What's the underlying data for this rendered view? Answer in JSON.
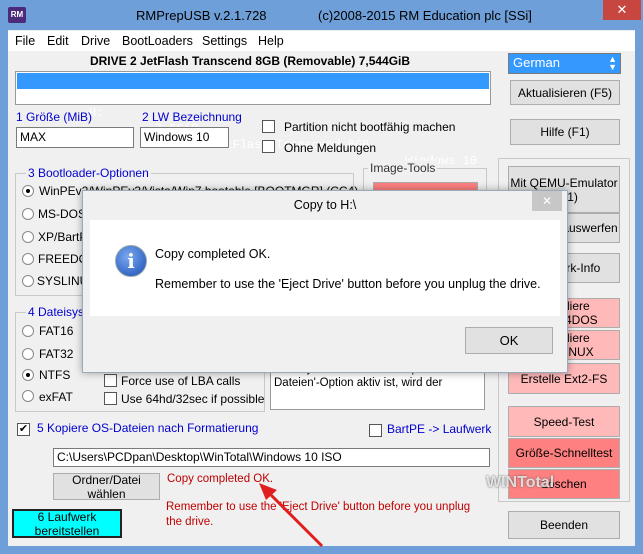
{
  "window": {
    "title": "RMPrepUSB v.2.1.728",
    "copyright": "(c)2008-2015 RM Education plc [SSi]",
    "icon_text": "RM"
  },
  "menu": [
    "File",
    "Edit",
    "Drive",
    "BootLoaders",
    "Settings",
    "Help"
  ],
  "drive_header": "DRIVE 2 JetFlash Transcend 8GB  (Removable) 7,544GiB",
  "drive_list": [
    {
      "drive": "DRIVE 2",
      "letter": "H:",
      "size": "7,5GiB",
      "name": "JetFlash Transcend 8GB",
      "label": "Windows 10"
    }
  ],
  "size": {
    "label": "1 Größe (MiB)",
    "value": "MAX"
  },
  "volume": {
    "label": "2 LW Bezeichnung",
    "value": "Windows 10"
  },
  "checks": {
    "no_boot": "Partition nicht bootfähig machen",
    "no_msg": "Ohne Meldungen"
  },
  "bootloader": {
    "title": "3 Bootloader-Optionen",
    "options": [
      "WinPEv2/WinPEv3/Vista/Win7 bootable [BOOTMGR] (CC4)",
      "MS-DOS",
      "XP/BartPE",
      "FREEDOS",
      "SYSLINUX"
    ],
    "selected": 0
  },
  "image_tools": {
    "title": "Image-Tools"
  },
  "filesystem": {
    "title": "4 Dateisystem",
    "options": [
      "FAT16",
      "FAT32",
      "NTFS",
      "exFAT"
    ],
    "selected": 2,
    "lba": "Force use of LBA calls",
    "hd64": "Use 64hd/32sec if possible",
    "info": "Dateisystem. Wenn die 'Kopiere OS-Dateien'-Option aktiv ist, wird der"
  },
  "copy_os": {
    "label": "5 Kopiere OS-Dateien nach Formatierung",
    "checked": true,
    "bartpe": "BartPE -> Laufwerk",
    "path": "C:\\Users\\PCDpan\\Desktop\\WinTotal\\Windows 10 ISO",
    "browse": "Ordner/Datei wählen"
  },
  "status": {
    "line1": "Copy completed OK.",
    "line2": "Remember to use the 'Eject Drive' button before you unplug the drive."
  },
  "prepare": "6 Laufwerk bereitstellen",
  "right": {
    "language": "German",
    "refresh": "Aktualisieren (F5)",
    "help": "Hilfe (F1)",
    "qemu": "Mit QEMU-Emulator (F11)",
    "eject": "Laufwerk auswerfen",
    "info": "Laufwerk-Info",
    "grub": "Installiere GRUB4DOS",
    "syslinux": "Installiere SYSLINUX",
    "ext2": "Erstelle Ext2-FS",
    "speed": "Speed-Test",
    "quick": "Größe-Schnelltest",
    "delete": "Löschen",
    "exit": "Beenden"
  },
  "dialog": {
    "title": "Copy to H:\\",
    "message": "Copy completed OK.",
    "detail": "Remember to use the 'Eject Drive' button before you unplug the drive.",
    "ok": "OK"
  },
  "watermark": "WINTotal"
}
